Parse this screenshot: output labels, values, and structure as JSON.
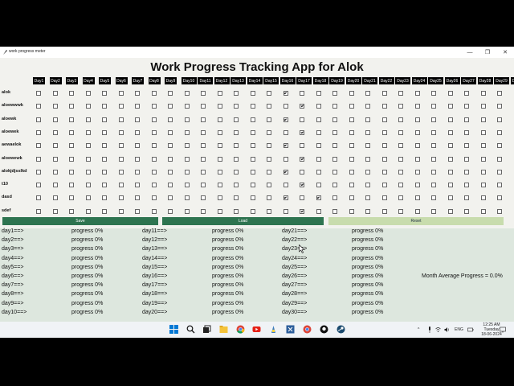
{
  "window": {
    "title": "work progress meter",
    "controls": [
      "—",
      "❐",
      "✕"
    ]
  },
  "app_title": "Work Progress Tracking App for Alok",
  "days": [
    "Day1",
    "Day2",
    "Day3",
    "Day4",
    "Day5",
    "Day6",
    "Day7",
    "Day8",
    "Day9",
    "Day10",
    "Day11",
    "Day12",
    "Day13",
    "Day14",
    "Day15",
    "Day16",
    "Day17",
    "Day18",
    "Day19",
    "Day20",
    "Day21",
    "Day22",
    "Day23",
    "Day24",
    "Day25",
    "Day26",
    "Day27",
    "Day28",
    "Day29",
    "Day30"
  ],
  "tasks": [
    {
      "label": "alok",
      "checked_days": [
        16
      ]
    },
    {
      "label": "aloewwwk",
      "checked_days": [
        17
      ]
    },
    {
      "label": "aloewk",
      "checked_days": [
        16
      ]
    },
    {
      "label": "aloewek",
      "checked_days": [
        17
      ]
    },
    {
      "label": "aewaelok",
      "checked_days": [
        16
      ]
    },
    {
      "label": "aloewewk",
      "checked_days": [
        17
      ]
    },
    {
      "label": "alokjdjsslkd",
      "checked_days": [
        16
      ]
    },
    {
      "label": "t10",
      "checked_days": [
        17
      ]
    },
    {
      "label": "dasd",
      "checked_days": [
        16,
        18
      ]
    },
    {
      "label": "sdef",
      "checked_days": [
        17
      ]
    }
  ],
  "buttons": {
    "save": "Save",
    "load": "Load",
    "reset": "Reset"
  },
  "colors": {
    "save_bg": "#2e7450",
    "load_bg": "#2e7450",
    "reset_bg": "#c8dcad",
    "panel_bg": "#dde7de",
    "header_bg": "#000000"
  },
  "progress": [
    {
      "day": "day1==>",
      "value": "progress 0%"
    },
    {
      "day": "day2==>",
      "value": "progress 0%"
    },
    {
      "day": "day3==>",
      "value": "progress 0%"
    },
    {
      "day": "day4==>",
      "value": "progress 0%"
    },
    {
      "day": "day5==>",
      "value": "progress 0%"
    },
    {
      "day": "day6==>",
      "value": "progress 0%"
    },
    {
      "day": "day7==>",
      "value": "progress 0%"
    },
    {
      "day": "day8==>",
      "value": "progress 0%"
    },
    {
      "day": "day9==>",
      "value": "progress 0%"
    },
    {
      "day": "day10==>",
      "value": "progress 0%"
    },
    {
      "day": "day11==>",
      "value": "progress 0%"
    },
    {
      "day": "day12==>",
      "value": "progress 0%"
    },
    {
      "day": "day13==>",
      "value": "progress 0%"
    },
    {
      "day": "day14==>",
      "value": "progress 0%"
    },
    {
      "day": "day15==>",
      "value": "progress 0%"
    },
    {
      "day": "day16==>",
      "value": "progress 0%"
    },
    {
      "day": "day17==>",
      "value": "progress 0%"
    },
    {
      "day": "day18==>",
      "value": "progress 0%"
    },
    {
      "day": "day19==>",
      "value": "progress 0%"
    },
    {
      "day": "day20==>",
      "value": "progress 0%"
    },
    {
      "day": "day21==>",
      "value": "progress 0%"
    },
    {
      "day": "day22==>",
      "value": "progress 0%"
    },
    {
      "day": "day23==>",
      "value": "progress 0%"
    },
    {
      "day": "day24==>",
      "value": "progress 0%"
    },
    {
      "day": "day25==>",
      "value": "progress 0%"
    },
    {
      "day": "day26==>",
      "value": "progress 0%"
    },
    {
      "day": "day27==>",
      "value": "progress 0%"
    },
    {
      "day": "day28==>",
      "value": "progress 0%"
    },
    {
      "day": "day29==>",
      "value": "progress 0%"
    },
    {
      "day": "day30==>",
      "value": "progress 0%"
    }
  ],
  "month_average": "Month Average Progress = 0.0%",
  "taskbar": {
    "icons": [
      "windows-start-icon",
      "search-icon",
      "task-view-icon",
      "file-explorer-icon",
      "youtube-icon",
      "chrome-icon",
      "python-idle-icon",
      "vscode-icon",
      "pycharm-icon",
      "chrome-icon",
      "github-icon",
      "steam-icon"
    ],
    "tray": {
      "language": "ENG",
      "time": "12:25 AM",
      "weekday": "Tuesday",
      "date": "18-06-2024"
    }
  }
}
